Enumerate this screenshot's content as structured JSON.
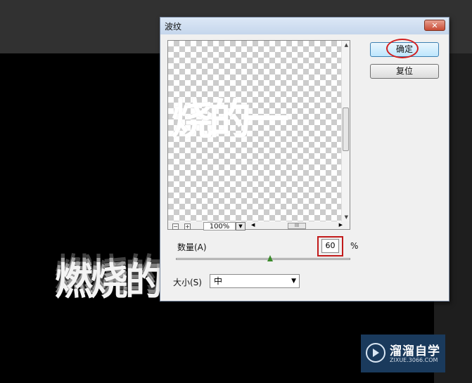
{
  "background": {
    "canvas_text": "燃烧的"
  },
  "dialog": {
    "title": "波纹",
    "close_glyph": "✕",
    "ok_label": "确定",
    "reset_label": "复位",
    "preview_text": "烧的一",
    "zoom": {
      "minus": "−",
      "plus": "+",
      "value": "100%",
      "dropdown": "▼"
    },
    "amount": {
      "label": "数量(A)",
      "value": "60",
      "unit": "%",
      "slider_fraction": 0.54
    },
    "size": {
      "label": "大小(S)",
      "selected": "中",
      "dropdown": "▼"
    },
    "scroll": {
      "up": "▲",
      "down": "▼",
      "left": "◀",
      "right": "▶",
      "grip": "≡",
      "hgrip": "III"
    }
  },
  "watermark": {
    "title": "溜溜自学",
    "subtitle": "ZIXUE.3066.COM"
  },
  "colors": {
    "accent_red": "#d21e1e",
    "slider_thumb": "#3a8a2a",
    "logo_bg": "#1a3a5c"
  }
}
